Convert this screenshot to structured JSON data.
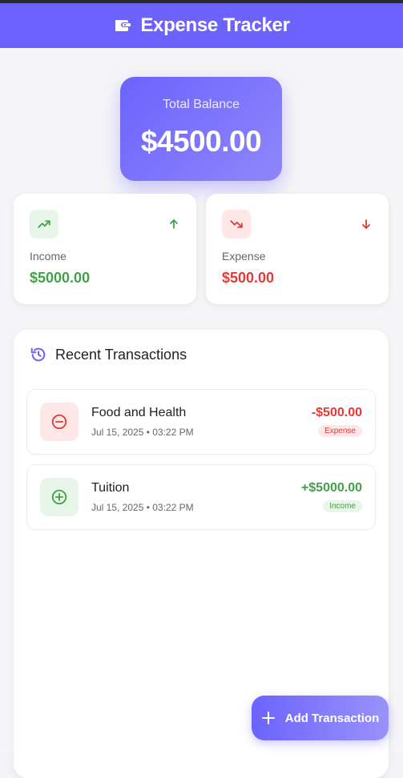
{
  "app": {
    "title": "Expense Tracker",
    "accent_color": "#6c63ff",
    "title_icon": "wallet-icon"
  },
  "balance": {
    "label": "Total Balance",
    "value": "$4500.00"
  },
  "income": {
    "label": "Income",
    "value": "$5000.00",
    "icon": "trending-up-icon",
    "arrow": "arrow-up-icon",
    "color": "#43a047"
  },
  "expense": {
    "label": "Expense",
    "value": "$500.00",
    "icon": "trending-down-icon",
    "arrow": "arrow-down-icon",
    "color": "#e53935"
  },
  "transactions": {
    "title": "Recent Transactions",
    "icon": "history-icon",
    "items": [
      {
        "name": "Food and Health",
        "date": "Jul 15, 2025 • 03:22 PM",
        "amount": "-$500.00",
        "type": "Expense",
        "icon": "minus-circle-icon"
      },
      {
        "name": "Tuition",
        "date": "Jul 15, 2025 • 03:22 PM",
        "amount": "+$5000.00",
        "type": "Income",
        "icon": "plus-circle-icon"
      }
    ]
  },
  "fab": {
    "label": "Add Transaction",
    "icon": "plus-icon"
  }
}
